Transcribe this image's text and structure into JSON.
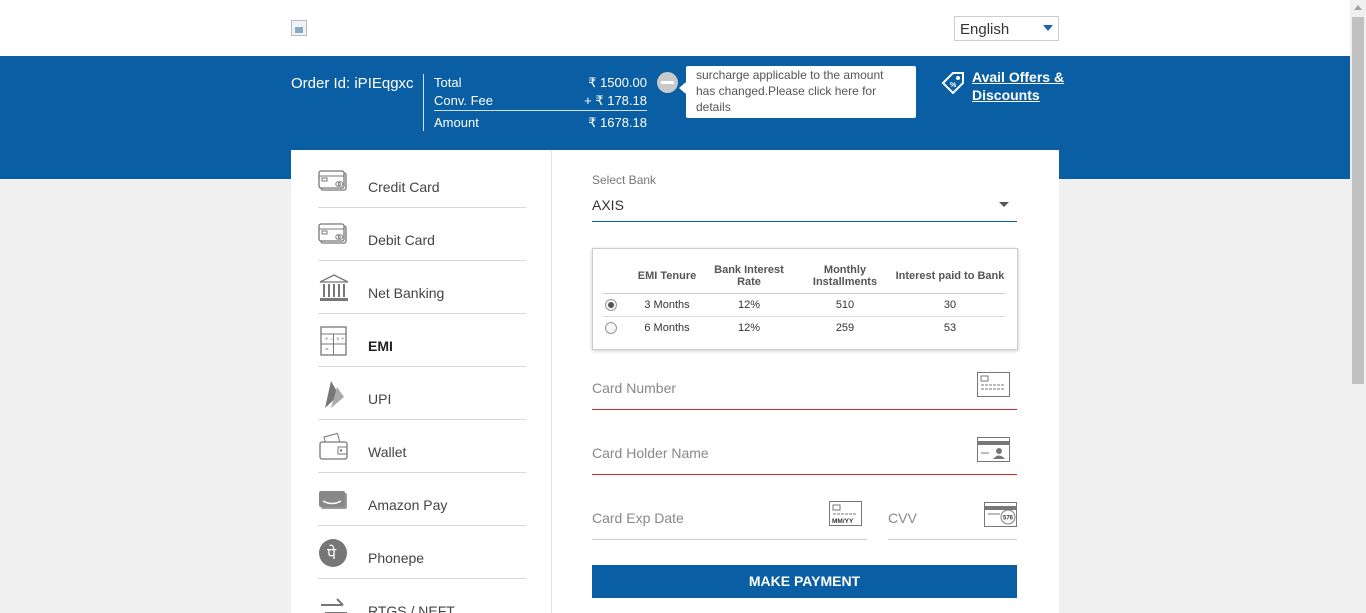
{
  "header": {
    "language": "English"
  },
  "order": {
    "id_text": "Order Id: iPIEqgxc",
    "total_label": "Total",
    "total_value": "₹ 1500.00",
    "fee_label": "Conv. Fee",
    "fee_value": "+ ₹ 178.18",
    "amount_label": "Amount",
    "amount_value": "₹ 1678.18"
  },
  "surcharge_tip": "surcharge applicable to the amount has changed.Please click here for details",
  "offers_label": "Avail Offers & Discounts",
  "menu": {
    "items": [
      {
        "label": "Credit Card"
      },
      {
        "label": "Debit Card"
      },
      {
        "label": "Net Banking"
      },
      {
        "label": "EMI"
      },
      {
        "label": "UPI"
      },
      {
        "label": "Wallet"
      },
      {
        "label": "Amazon Pay"
      },
      {
        "label": "Phonepe"
      },
      {
        "label": "RTGS / NEFT"
      }
    ]
  },
  "bank": {
    "label": "Select Bank",
    "value": "AXIS"
  },
  "emi_table": {
    "headers": [
      "EMI Tenure",
      "Bank Interest Rate",
      "Monthly Installments",
      "Interest paid to Bank"
    ],
    "rows": [
      {
        "tenure": "3 Months",
        "rate": "12%",
        "installment": "510",
        "interest": "30",
        "selected": true
      },
      {
        "tenure": "6 Months",
        "rate": "12%",
        "installment": "259",
        "interest": "53",
        "selected": false
      }
    ]
  },
  "form": {
    "card_number": "Card Number",
    "holder_name": "Card Holder Name",
    "exp_date": "Card Exp Date",
    "cvv": "CVV",
    "exp_icon_text": "MM/YY",
    "cvv_icon_text": "576",
    "pay_button": "MAKE PAYMENT"
  },
  "colors": {
    "brand_blue": "#0a5fa4",
    "error_red": "#c9302c"
  }
}
